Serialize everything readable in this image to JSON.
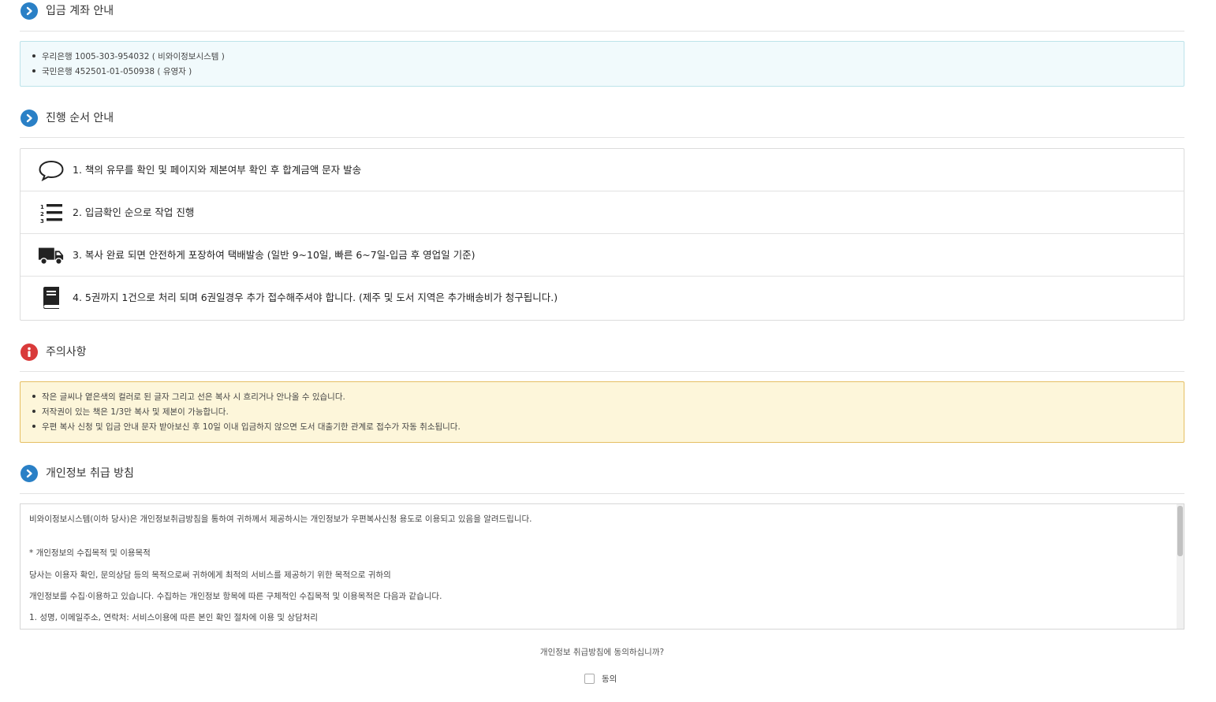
{
  "sections": {
    "account": {
      "title": "입금 계좌 안내",
      "items": [
        "우리은행 1005-303-954032 ( 비와이정보시스템 )",
        "국민은행 452501-01-050938 ( 유영자 )"
      ]
    },
    "process": {
      "title": "진행 순서 안내",
      "steps": [
        {
          "icon": "speech-bubble-icon",
          "text": "1. 책의 유무를 확인 및 페이지와 제본여부 확인 후 합계금액 문자 발송"
        },
        {
          "icon": "numbered-list-icon",
          "text": "2. 입금확인 순으로 작업 진행"
        },
        {
          "icon": "truck-icon",
          "text": "3. 복사 완료 되면 안전하게 포장하여 택배발송 (일반 9~10일, 빠른 6~7일-입금 후 영업일 기준)"
        },
        {
          "icon": "book-icon",
          "text": "4. 5권까지 1건으로 처리 되며 6권일경우 추가 접수해주셔야 합니다. (제주 및 도서 지역은 추가배송비가 청구됩니다.)"
        }
      ]
    },
    "caution": {
      "title": "주의사항",
      "items": [
        "작은 글씨나 옅은색의 컬러로 된 글자 그리고 선은 복사 시 흐리거나 안나올 수 있습니다.",
        "저작권이 있는 책은 1/3만 복사 및 제본이 가능합니다.",
        "우편 복사 신청 및 입금 안내 문자 받아보신 후 10일 이내 입금하지 않으면 도서 대출기한 관계로 접수가 자동 취소됩니다."
      ]
    },
    "privacy": {
      "title": "개인정보 취급 방침",
      "lines": [
        "비와이정보시스템(이하 당사)은 개인정보취급방침을 통하여 귀하께서 제공하시는 개인정보가 우편복사신청 용도로 이용되고 있음을 알려드립니다.",
        "* 개인정보의 수집목적 및 이용목적",
        "당사는 이용자 확인, 문의상담 등의 목적으로써 귀하에게 최적의 서비스를 제공하기 위한 목적으로 귀하의",
        "개인정보를 수집·이용하고 있습니다. 수집하는 개인정보 항목에 따른 구체적인 수집목적 및 이용목적은 다음과 같습니다.",
        "1. 성명, 이메일주소, 연락처: 서비스이용에 따른 본인 확인 절차에 이용 및 상담처리"
      ]
    }
  },
  "agreement": {
    "question": "개인정보 취급방침에 동의하십니까?",
    "checkbox_label": "동의",
    "checked": false
  },
  "colors": {
    "accent_blue": "#2a80c6",
    "alert_red": "#d93a3a",
    "info_bg": "#f1fafc",
    "warn_bg": "#fdf6da"
  }
}
